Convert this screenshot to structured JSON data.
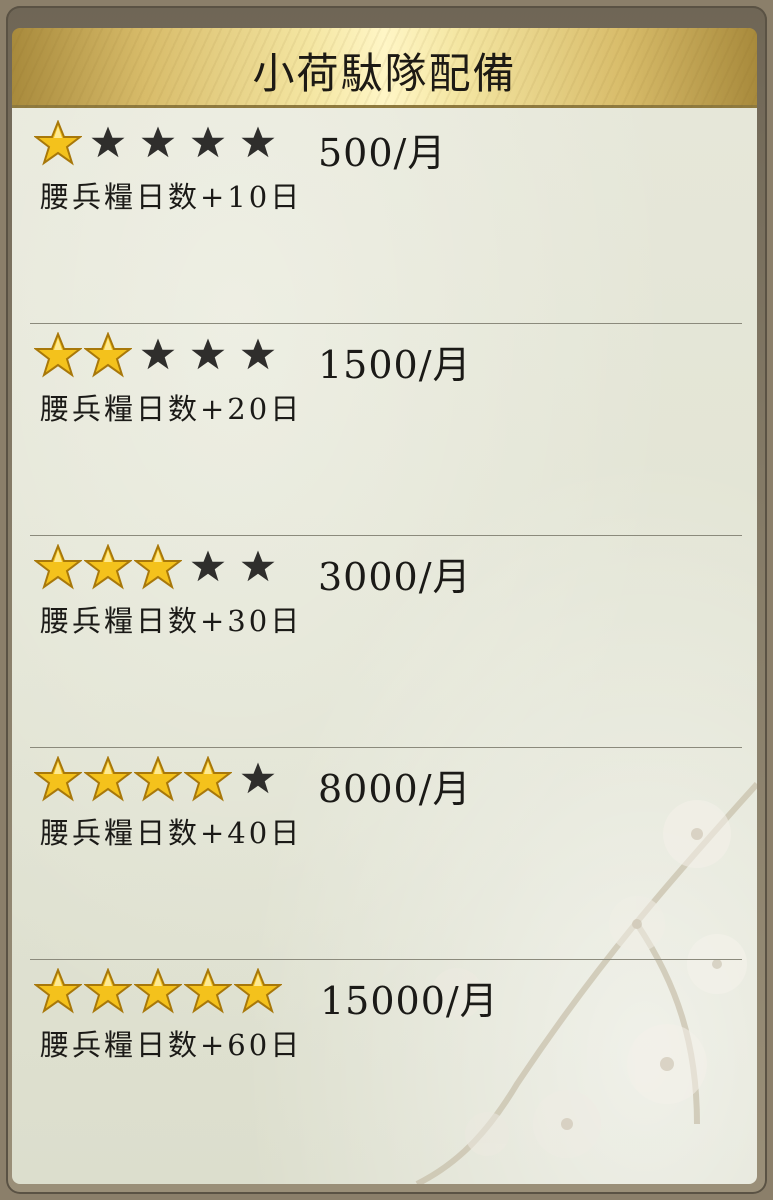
{
  "title": "小荷駄隊配備",
  "rows": [
    {
      "stars": 1,
      "cost": "500/月",
      "effect": "腰兵糧日数+10日"
    },
    {
      "stars": 2,
      "cost": "1500/月",
      "effect": "腰兵糧日数+20日"
    },
    {
      "stars": 3,
      "cost": "3000/月",
      "effect": "腰兵糧日数+30日"
    },
    {
      "stars": 4,
      "cost": "8000/月",
      "effect": "腰兵糧日数+40日"
    },
    {
      "stars": 5,
      "cost": "15000/月",
      "effect": "腰兵糧日数+60日"
    }
  ],
  "max_stars": 5,
  "colors": {
    "star_on": "#f4c21c",
    "star_off": "#2f2e2c",
    "header_gold": "#e8d27e",
    "panel": "#e2e4d4"
  }
}
